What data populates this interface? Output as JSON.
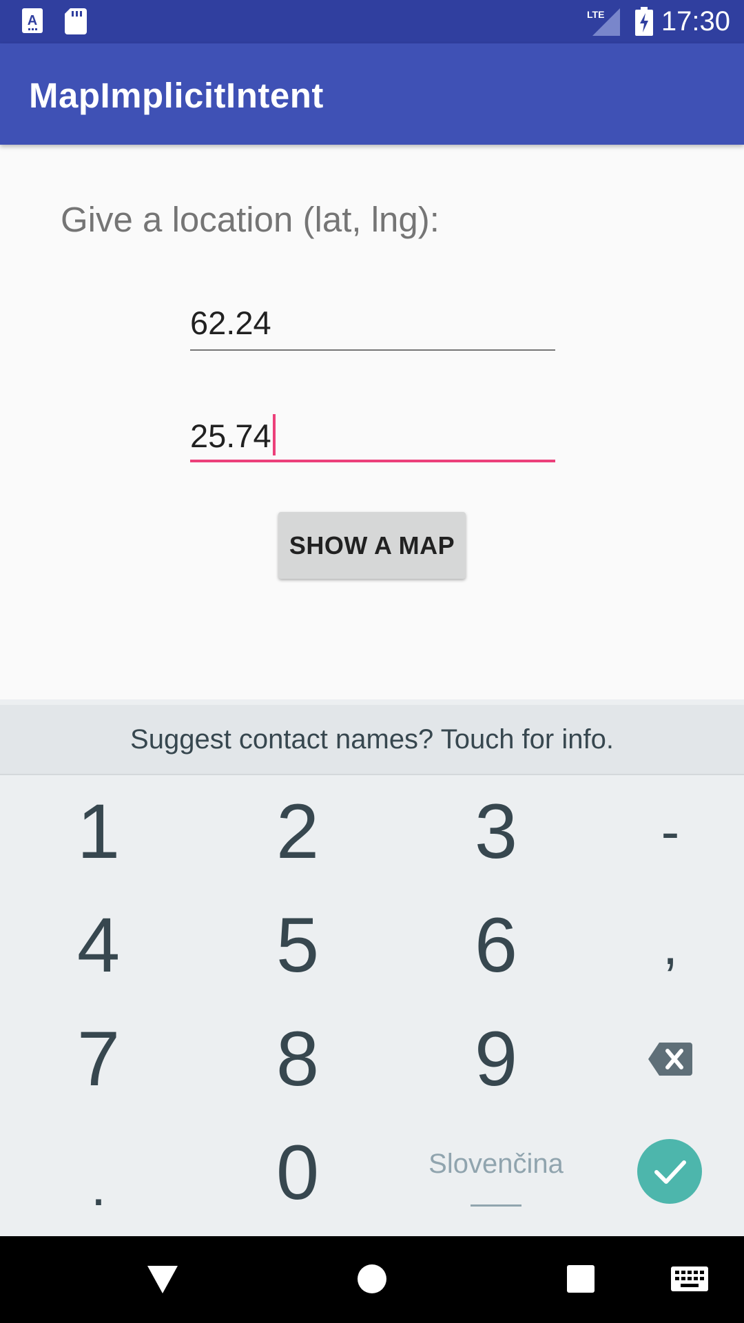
{
  "status_bar": {
    "time": "17:30",
    "network": "LTE",
    "icons": [
      "app-a-icon",
      "sd-card-icon",
      "lte-signal-icon",
      "battery-charging-icon"
    ]
  },
  "app_bar": {
    "title": "MapImplicitIntent"
  },
  "main": {
    "prompt": "Give a location (lat, lng):",
    "latitude_value": "62.24",
    "longitude_value": "25.74",
    "show_map_button": "SHOW A MAP"
  },
  "keyboard": {
    "suggestion": "Suggest contact names? Touch for info.",
    "keys": [
      "1",
      "2",
      "3",
      "-",
      "4",
      "5",
      "6",
      ",",
      "7",
      "8",
      "9",
      "0",
      "."
    ],
    "language": "Slovenčina",
    "colors": {
      "accent": "#ec407a",
      "enter": "#4db6ac",
      "primary": "#3f51b5",
      "primary_dark": "#303f9f"
    }
  },
  "nav_bar": {
    "icons": [
      "back-icon",
      "home-icon",
      "recents-icon",
      "keyboard-icon"
    ]
  }
}
